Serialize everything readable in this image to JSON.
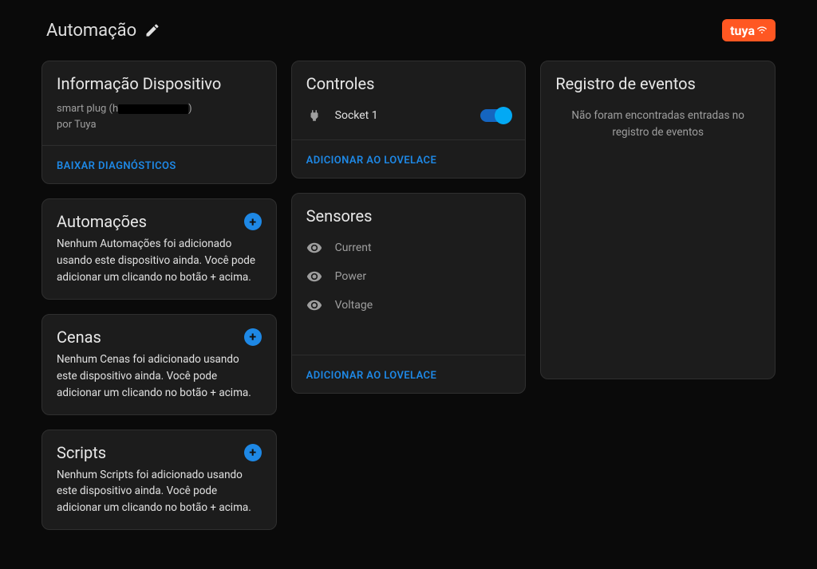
{
  "header": {
    "title": "Automação",
    "brand": "tuya"
  },
  "deviceInfo": {
    "title": "Informação Dispositivo",
    "deviceNamePrefix": "smart plug (h",
    "deviceNameSuffix": ")",
    "byLine": "por Tuya",
    "downloadDiagnostics": "BAIXAR DIAGNÓSTICOS"
  },
  "automations": {
    "title": "Automações",
    "body": "Nenhum Automações foi adicionado usando este dispositivo ainda. Você pode adicionar um clicando no botão + acima."
  },
  "scenes": {
    "title": "Cenas",
    "body": "Nenhum Cenas foi adicionado usando este dispositivo ainda. Você pode adicionar um clicando no botão + acima."
  },
  "scripts": {
    "title": "Scripts",
    "body": "Nenhum Scripts foi adicionado usando este dispositivo ainda. Você pode adicionar um clicando no botão + acima."
  },
  "controls": {
    "title": "Controles",
    "items": [
      {
        "label": "Socket 1",
        "on": true
      }
    ],
    "addToLovelace": "ADICIONAR AO LOVELACE"
  },
  "sensors": {
    "title": "Sensores",
    "items": [
      {
        "label": "Current"
      },
      {
        "label": "Power"
      },
      {
        "label": "Voltage"
      }
    ],
    "addToLovelace": "ADICIONAR AO LOVELACE"
  },
  "logbook": {
    "title": "Registro de eventos",
    "empty": "Não foram encontradas entradas no registro de eventos"
  }
}
